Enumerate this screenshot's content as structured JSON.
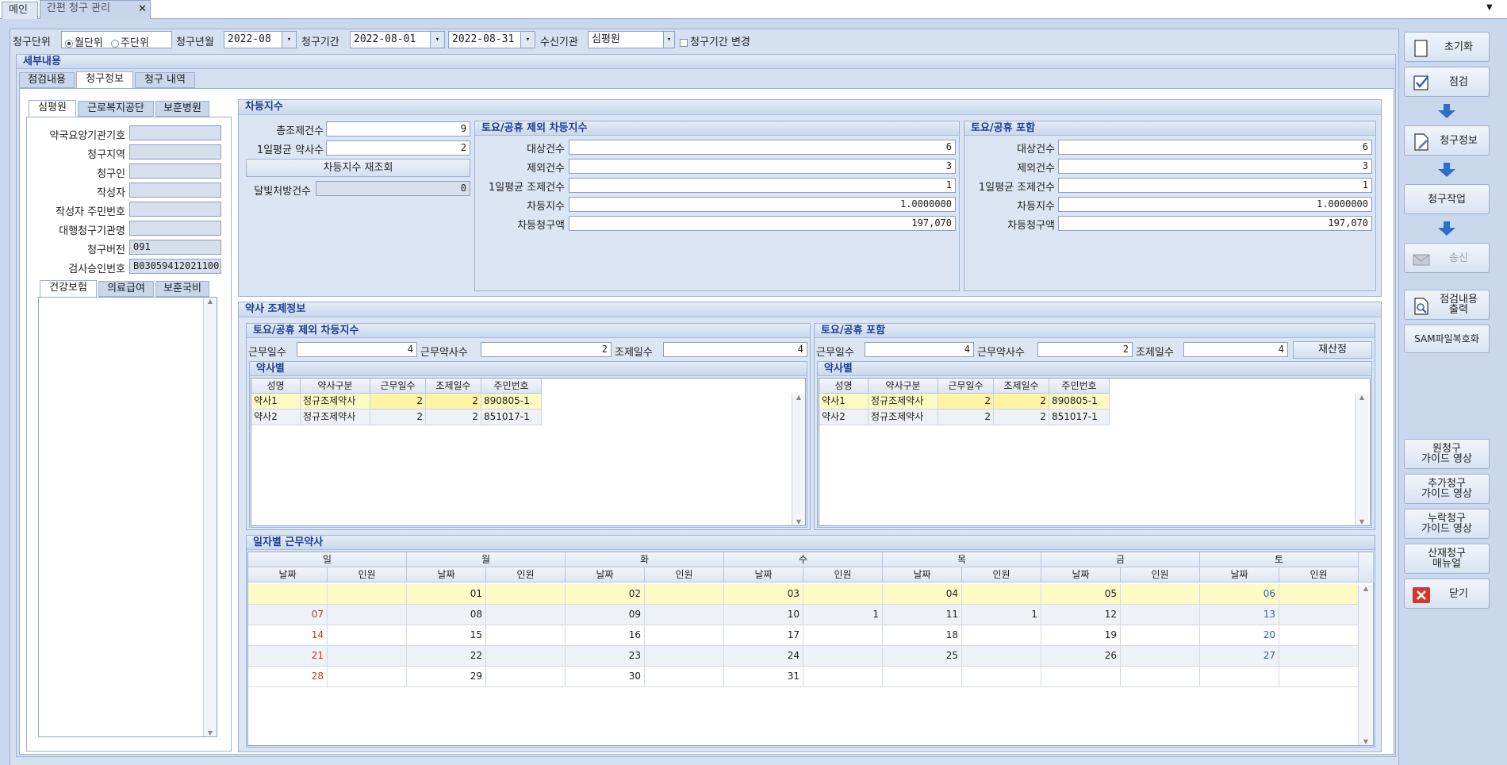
{
  "tabs": {
    "main": "메인",
    "active": "간편 청구 관리",
    "close": "✕"
  },
  "toolbar": {
    "unit_label": "청구단위",
    "monthly": "월단위",
    "weekly": "주단위",
    "yearmonth_label": "청구년월",
    "yearmonth": "2022-08",
    "period_label": "청구기간",
    "from": "2022-08-01",
    "to": "2022-08-31",
    "receiver_label": "수신기관",
    "receiver": "심평원",
    "period_change": "청구기간 변경"
  },
  "section": {
    "title": "세부내용",
    "tab1": "점검내용",
    "tab2": "청구정보",
    "tab3": "청구 내역"
  },
  "left": {
    "tab1": "심평원",
    "tab2": "근로복지공단",
    "tab3": "보훈병원",
    "fields": [
      {
        "label": "약국요양기관기호",
        "value": ""
      },
      {
        "label": "청구지역",
        "value": ""
      },
      {
        "label": "청구인",
        "value": ""
      },
      {
        "label": "작성자",
        "value": ""
      },
      {
        "label": "작성자 주민번호",
        "value": ""
      },
      {
        "label": "대행청구기관명",
        "value": ""
      },
      {
        "label": "청구버전",
        "value": "091"
      },
      {
        "label": "검사승인번호",
        "value": "B03059412021100"
      }
    ],
    "ins_tab1": "건강보험",
    "ins_tab2": "의료급여",
    "ins_tab3": "보훈국비"
  },
  "cd": {
    "title": "차등지수",
    "total_label": "총조제건수",
    "total": "9",
    "avg_label": "1일평균 약사수",
    "avg": "2",
    "recalc": "차등지수 재조회",
    "moon_label": "달빛처방건수",
    "moon": "0",
    "ex": {
      "title": "토요/공휴 제외 차등지수",
      "target_label": "대상건수",
      "target": "6",
      "excl_label": "제외건수",
      "excl": "3",
      "daily_label": "1일평균 조제건수",
      "daily": "1",
      "idx_label": "차등지수",
      "idx": "1.0000000",
      "amt_label": "차등청구액",
      "amt": "197,070"
    },
    "inc": {
      "title": "토요/공휴 포함",
      "target_label": "대상건수",
      "target": "6",
      "excl_label": "제외건수",
      "excl": "3",
      "daily_label": "1일평균 조제건수",
      "daily": "1",
      "idx_label": "차등지수",
      "idx": "1.0000000",
      "amt_label": "차등청구액",
      "amt": "197,070"
    }
  },
  "ph": {
    "title": "약사 조제정보",
    "ex": {
      "title": "토요/공휴 제외 차등지수",
      "wd_label": "근무일수",
      "wd": "4",
      "wp_label": "근무약사수",
      "wp": "2",
      "dd_label": "조제일수",
      "dd": "4"
    },
    "inc": {
      "title": "토요/공휴 포함",
      "wd_label": "근무일수",
      "wd": "4",
      "wp_label": "근무약사수",
      "wp": "2",
      "dd_label": "조제일수",
      "dd": "4",
      "recalc": "재산정"
    },
    "by_title": "약사별",
    "cols": {
      "name": "성명",
      "type": "약사구분",
      "wd": "근무일수",
      "dd": "조제일수",
      "id": "주민번호"
    },
    "rows": [
      {
        "name": "약사1",
        "type": "정규조제약사",
        "wd": "2",
        "dd": "2",
        "id": "890805-1"
      },
      {
        "name": "약사2",
        "type": "정규조제약사",
        "wd": "2",
        "dd": "2",
        "id": "851017-1"
      }
    ]
  },
  "cal": {
    "title": "일자별 근무약사",
    "days": [
      "일",
      "월",
      "화",
      "수",
      "목",
      "금",
      "토"
    ],
    "date_label": "날짜",
    "people_label": "인원",
    "weeks": [
      [
        [
          "",
          ""
        ],
        [
          "01",
          ""
        ],
        [
          "02",
          ""
        ],
        [
          "03",
          ""
        ],
        [
          "04",
          ""
        ],
        [
          "05",
          ""
        ],
        [
          "06",
          ""
        ]
      ],
      [
        [
          "07",
          ""
        ],
        [
          "08",
          ""
        ],
        [
          "09",
          ""
        ],
        [
          "10",
          "1"
        ],
        [
          "11",
          "1"
        ],
        [
          "12",
          ""
        ],
        [
          "13",
          ""
        ]
      ],
      [
        [
          "14",
          ""
        ],
        [
          "15",
          ""
        ],
        [
          "16",
          ""
        ],
        [
          "17",
          ""
        ],
        [
          "18",
          ""
        ],
        [
          "19",
          ""
        ],
        [
          "20",
          ""
        ]
      ],
      [
        [
          "21",
          ""
        ],
        [
          "22",
          ""
        ],
        [
          "23",
          ""
        ],
        [
          "24",
          ""
        ],
        [
          "25",
          ""
        ],
        [
          "26",
          ""
        ],
        [
          "27",
          ""
        ]
      ],
      [
        [
          "28",
          ""
        ],
        [
          "29",
          ""
        ],
        [
          "30",
          ""
        ],
        [
          "31",
          ""
        ],
        [
          "",
          ""
        ],
        [
          "",
          ""
        ],
        [
          "",
          ""
        ]
      ]
    ]
  },
  "right": {
    "reset": "초기화",
    "check": "점검",
    "claim_info": "청구정보",
    "claim_work": "청구작업",
    "send": "송신",
    "print": "점검내용\n출력",
    "sam": "SAM파일복호화",
    "guide1": "원청구\n가이드 영상",
    "guide2": "추가청구\n가이드 영상",
    "guide3": "누락청구\n가이드 영상",
    "guide4": "산재청구\n매뉴얼",
    "close": "닫기"
  }
}
